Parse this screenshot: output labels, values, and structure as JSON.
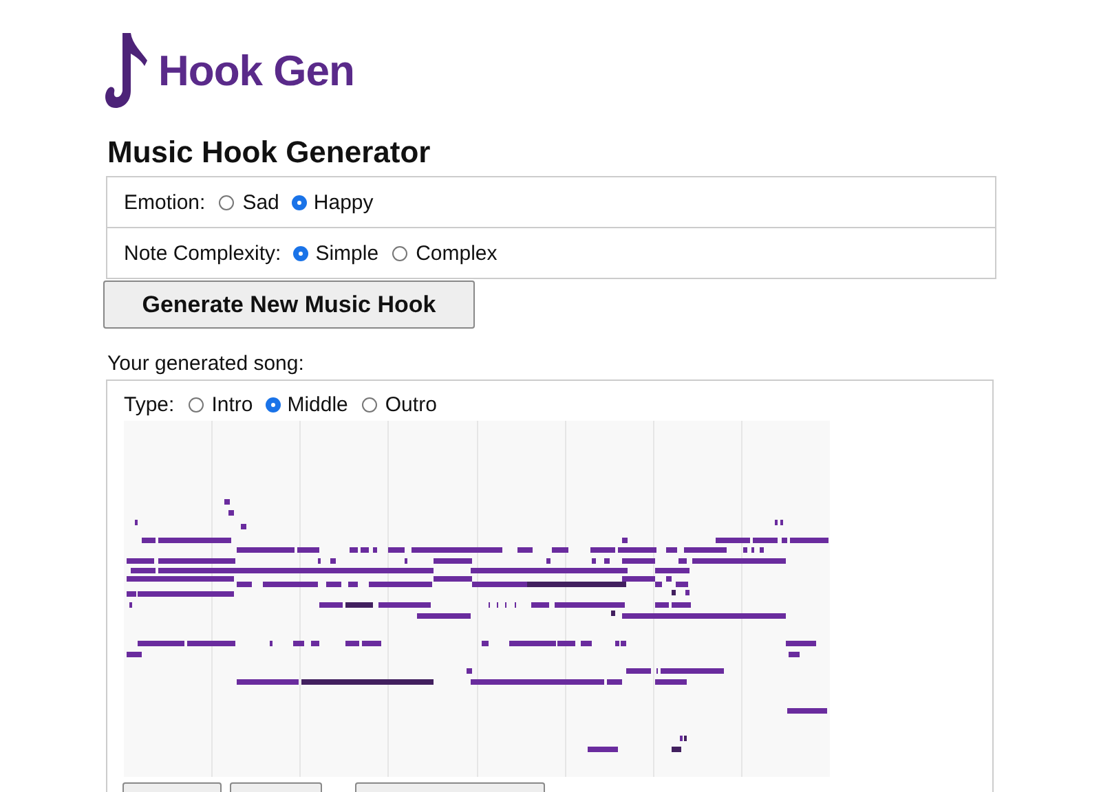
{
  "logo": {
    "text": "Hook Gen"
  },
  "title": "Music Hook Generator",
  "options": [
    {
      "label": "Emotion:",
      "choices": [
        {
          "label": "Sad",
          "selected": false
        },
        {
          "label": "Happy",
          "selected": true
        }
      ]
    },
    {
      "label": "Note Complexity:",
      "choices": [
        {
          "label": "Simple",
          "selected": true
        },
        {
          "label": "Complex",
          "selected": false
        }
      ]
    }
  ],
  "generate_button": "Generate New Music Hook",
  "song_label": "Your generated song:",
  "song": {
    "type_label": "Type:",
    "types": [
      {
        "label": "Intro",
        "selected": false
      },
      {
        "label": "Middle",
        "selected": true
      },
      {
        "label": "Outro",
        "selected": false
      }
    ]
  },
  "bottom_buttons": [
    {
      "kind": "button"
    },
    {
      "kind": "button"
    },
    {
      "kind": "button"
    }
  ]
}
